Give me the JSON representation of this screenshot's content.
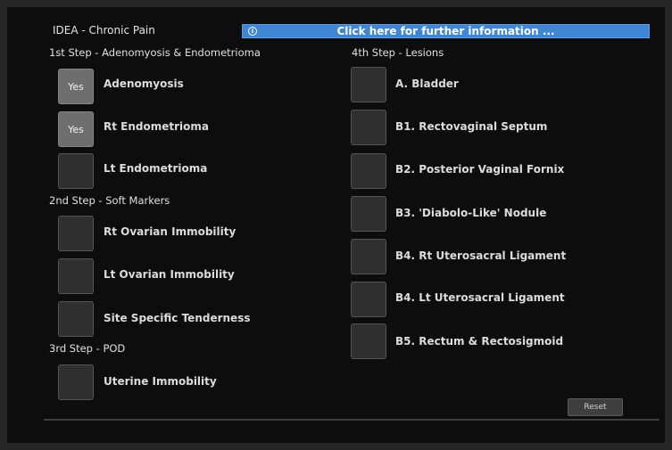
{
  "header": {
    "title": "IDEA - Chronic Pain",
    "info_icon": "info-circle-icon",
    "info_text": "Click here for further information ..."
  },
  "steps": {
    "step1": "1st Step - Adenomyosis & Endometrioma",
    "step2": "2nd Step - Soft Markers",
    "step3": "3rd Step - POD",
    "step4": "4th Step - Lesions"
  },
  "items": {
    "adenomyosis": {
      "label": "Adenomyosis",
      "state": "Yes"
    },
    "rt_endometrioma": {
      "label": "Rt Endometrioma",
      "state": "Yes"
    },
    "lt_endometrioma": {
      "label": "Lt Endometrioma",
      "state": ""
    },
    "rt_ovarian": {
      "label": "Rt Ovarian Immobility",
      "state": ""
    },
    "lt_ovarian": {
      "label": "Lt Ovarian Immobility",
      "state": ""
    },
    "site_tenderness": {
      "label": "Site Specific Tenderness",
      "state": ""
    },
    "uterine": {
      "label": "Uterine Immobility",
      "state": ""
    },
    "bladder": {
      "label": "A. Bladder",
      "state": ""
    },
    "rectovaginal": {
      "label": "B1. Rectovaginal Septum",
      "state": ""
    },
    "post_vaginal": {
      "label": "B2. Posterior Vaginal Fornix",
      "state": ""
    },
    "diabolo": {
      "label": "B3. 'Diabolo-Like' Nodule",
      "state": ""
    },
    "rt_uterosacral": {
      "label": "B4. Rt Uterosacral Ligament",
      "state": ""
    },
    "lt_uterosacral": {
      "label": "B4. Lt Uterosacral Ligament",
      "state": ""
    },
    "rectum": {
      "label": "B5. Rectum & Rectosigmoid",
      "state": ""
    }
  },
  "footer": {
    "reset_label": "Reset"
  },
  "colors": {
    "info_bar": "#3f86d4",
    "background": "#0d0d0d",
    "button_on": "#6e6e6e",
    "button_off": "#2f2f2f"
  }
}
